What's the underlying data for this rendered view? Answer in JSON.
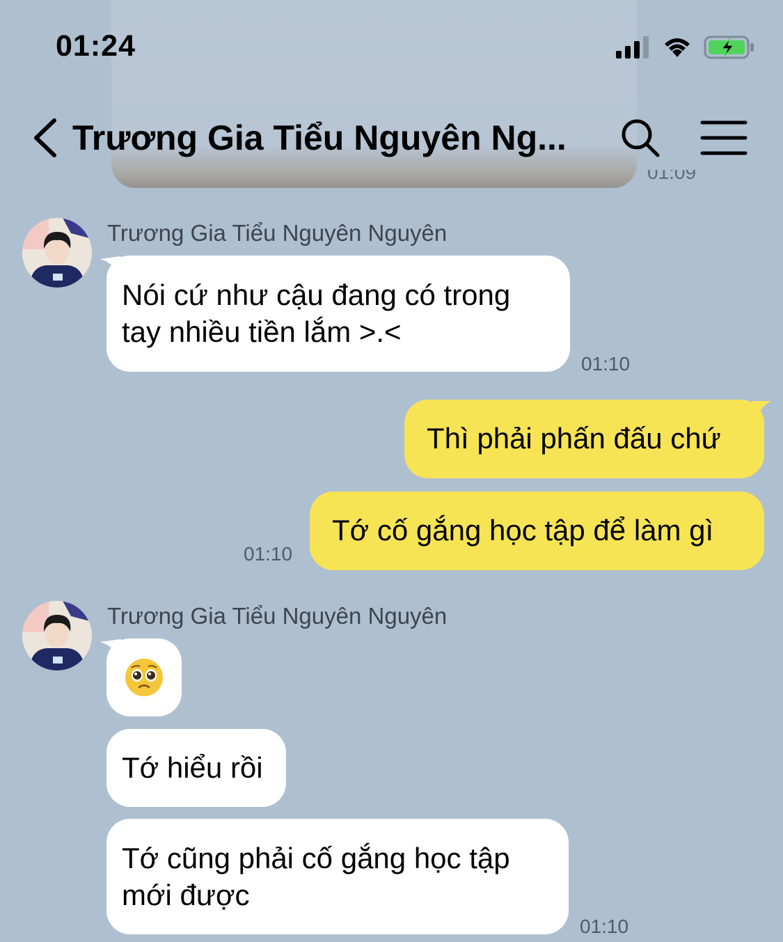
{
  "status_bar": {
    "time": "01:24",
    "icons": [
      "signal-icon",
      "wifi-icon",
      "battery-charging-icon"
    ]
  },
  "header": {
    "title": "Trương Gia Tiểu Nguyên Ng...",
    "icons": [
      "back-icon",
      "search-icon",
      "menu-icon"
    ]
  },
  "previous": {
    "time": "01:09"
  },
  "messages": [
    {
      "sender": "Trương Gia Tiểu Nguyên Nguyên",
      "direction": "in",
      "text": "Nói cứ như cậu đang có trong tay nhiều tiền lắm >.<",
      "time": "01:10"
    },
    {
      "direction": "out",
      "text": "Thì phải phấn đấu chứ"
    },
    {
      "direction": "out",
      "text": "Tớ cố gắng học tập để làm gì",
      "time": "01:10"
    },
    {
      "sender": "Trương Gia Tiểu Nguyên Nguyên",
      "direction": "in",
      "text": "🥺",
      "emoji_name": "pleading-face-emoji"
    },
    {
      "direction": "in",
      "text": "Tớ hiểu rồi"
    },
    {
      "direction": "in",
      "text": "Tớ cũng phải cố gắng học tập mới được",
      "time": "01:10"
    }
  ],
  "colors": {
    "background": "#aebfd0",
    "incoming_bubble": "#ffffff",
    "outgoing_bubble": "#f7e455"
  }
}
